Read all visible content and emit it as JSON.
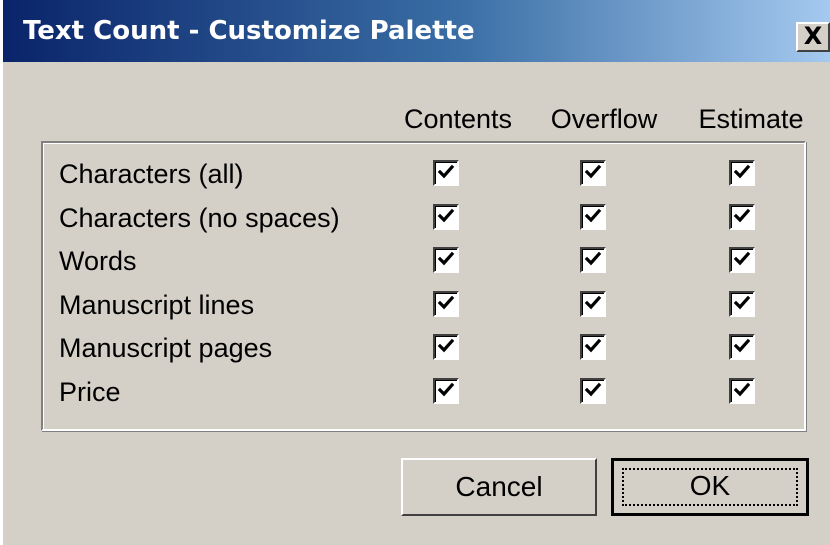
{
  "window": {
    "title": "Text Count - Customize Palette",
    "close_label": "X"
  },
  "columns": [
    "Contents",
    "Overflow",
    "Estimate"
  ],
  "rows": [
    {
      "label": "Characters (all)",
      "checks": [
        true,
        true,
        true
      ]
    },
    {
      "label": "Characters (no spaces)",
      "checks": [
        true,
        true,
        true
      ]
    },
    {
      "label": "Words",
      "checks": [
        true,
        true,
        true
      ]
    },
    {
      "label": "Manuscript lines",
      "checks": [
        true,
        true,
        true
      ]
    },
    {
      "label": "Manuscript pages",
      "checks": [
        true,
        true,
        true
      ]
    },
    {
      "label": "Price",
      "checks": [
        true,
        true,
        true
      ]
    }
  ],
  "buttons": {
    "cancel_label": "Cancel",
    "ok_label": "OK"
  },
  "colors": {
    "dialog_face": "#d4d0c8",
    "title_gradient_start": "#0a246a",
    "title_gradient_end": "#a6caf0"
  }
}
